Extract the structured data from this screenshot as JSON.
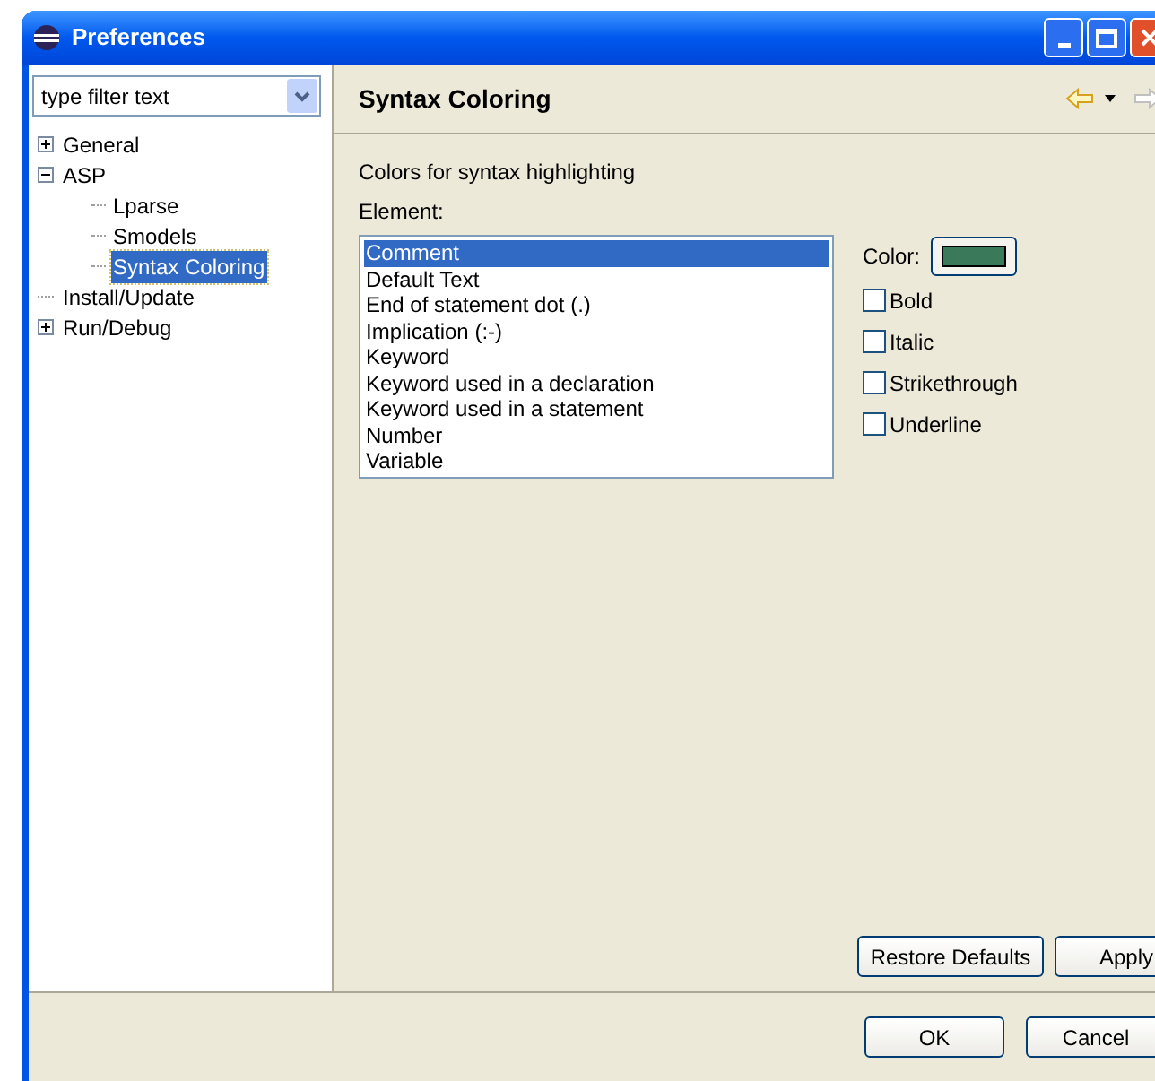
{
  "window": {
    "title": "Preferences"
  },
  "filter": {
    "placeholder": "type filter text"
  },
  "tree": [
    {
      "kind": "folder",
      "label": "General",
      "expanded": false,
      "selected": false
    },
    {
      "kind": "folder",
      "label": "ASP",
      "expanded": true,
      "selected": false,
      "children": [
        {
          "label": "Lparse",
          "selected": false
        },
        {
          "label": "Smodels",
          "selected": false
        },
        {
          "label": "Syntax Coloring",
          "selected": true
        }
      ]
    },
    {
      "kind": "leaf",
      "label": "Install/Update",
      "selected": false
    },
    {
      "kind": "folder",
      "label": "Run/Debug",
      "expanded": false,
      "selected": false
    }
  ],
  "page": {
    "title": "Syntax Coloring",
    "description": "Colors for syntax highlighting",
    "element_label": "Element:"
  },
  "elements": [
    {
      "label": "Comment",
      "selected": true
    },
    {
      "label": "Default Text",
      "selected": false
    },
    {
      "label": "End of statement dot (.)",
      "selected": false
    },
    {
      "label": "Implication (:-)",
      "selected": false
    },
    {
      "label": "Keyword",
      "selected": false
    },
    {
      "label": "Keyword used in a declaration",
      "selected": false
    },
    {
      "label": "Keyword used in a statement",
      "selected": false
    },
    {
      "label": "Number",
      "selected": false
    },
    {
      "label": "Variable",
      "selected": false
    }
  ],
  "color": {
    "label": "Color:",
    "color": "#3a7a5a"
  },
  "options": [
    {
      "label": "Bold",
      "checked": false
    },
    {
      "label": "Italic",
      "checked": false
    },
    {
      "label": "Strikethrough",
      "checked": false
    },
    {
      "label": "Underline",
      "checked": false
    }
  ],
  "page_buttons": [
    "Restore Defaults",
    "Apply"
  ],
  "dialog_buttons": [
    "OK",
    "Cancel"
  ]
}
